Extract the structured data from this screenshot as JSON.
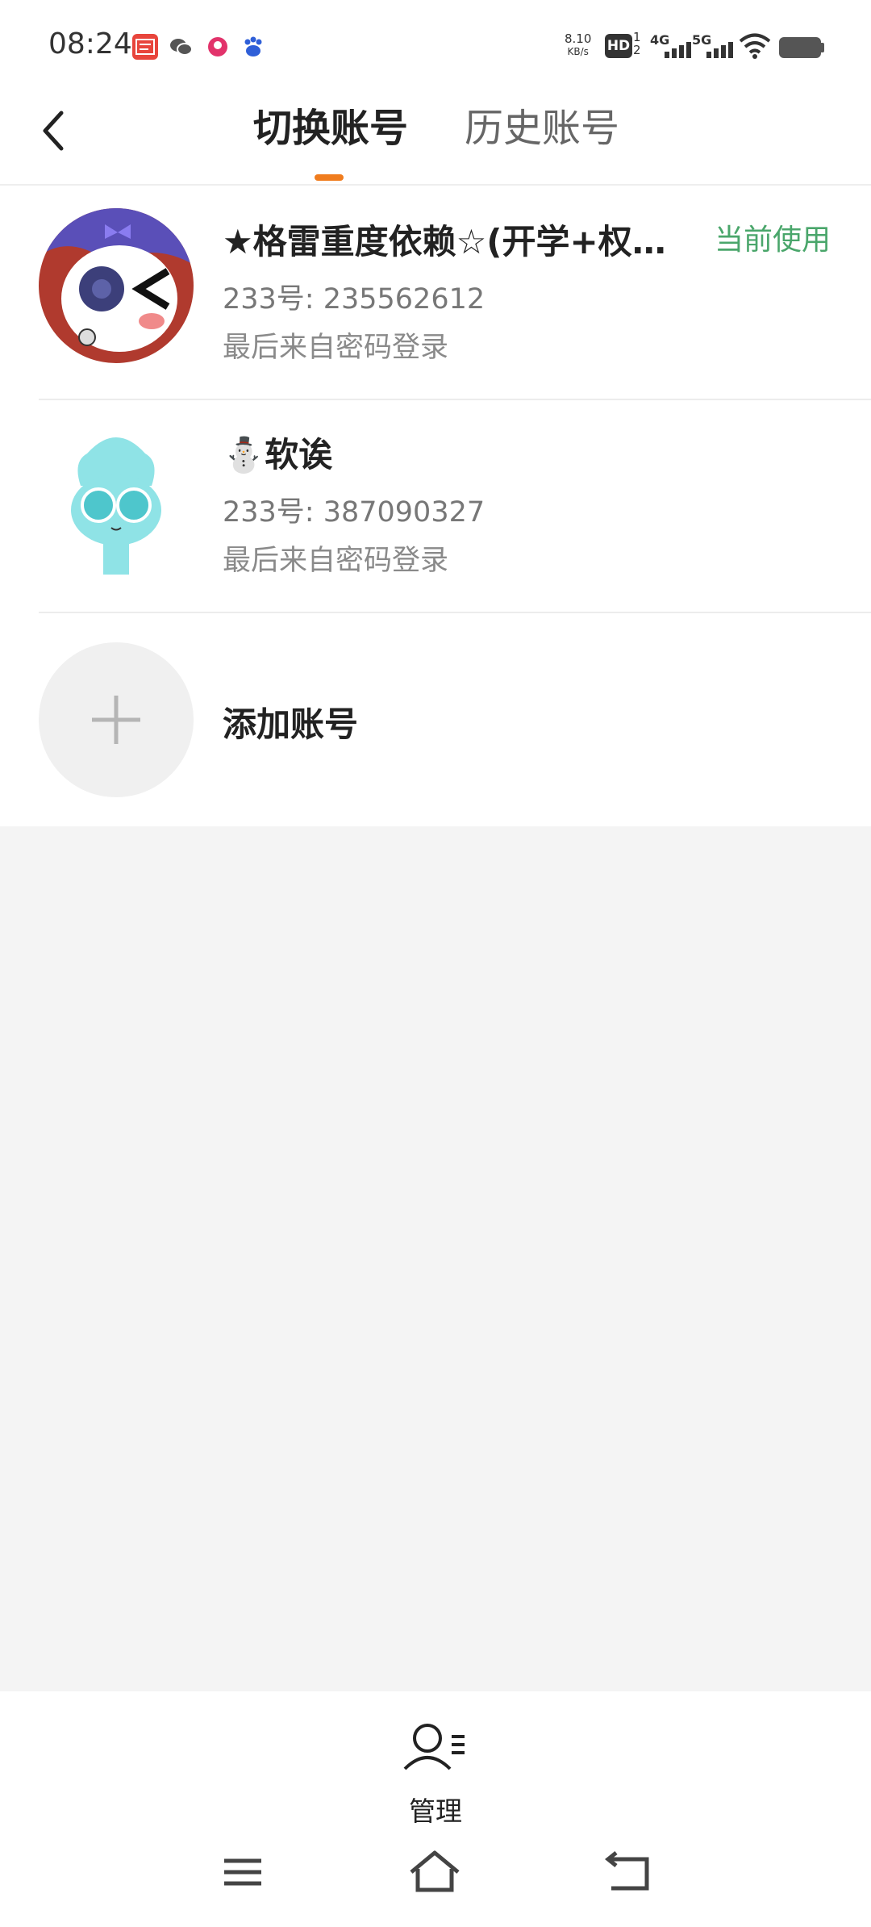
{
  "status_bar": {
    "time": "08:24",
    "net_speed_value": "8.10",
    "net_speed_unit": "KB/s",
    "hd_label": "HD",
    "sim_slots": "1\n2",
    "signal1_label": "4G",
    "signal2_label": "5G",
    "app_icons": [
      "toutiao-app-icon",
      "wechat-icon",
      "app-notification-icon",
      "baidu-icon"
    ]
  },
  "header": {
    "tabs": [
      {
        "label": "切换账号",
        "active": true
      },
      {
        "label": "历史账号",
        "active": false
      }
    ],
    "indicator_color": "#f07c1e"
  },
  "accounts": [
    {
      "name": "★格雷重度依赖☆(开学+权威...",
      "status": "当前使用",
      "id_text": "233号: 235562612",
      "login_text": "最后来自密码登录"
    },
    {
      "name": "⛄软诶",
      "id_text": "233号: 387090327",
      "login_text": "最后来自密码登录"
    }
  ],
  "add_account": {
    "label": "添加账号"
  },
  "bottom": {
    "manage_label": "管理",
    "nav": [
      "menu-icon",
      "home-icon",
      "back-icon"
    ]
  },
  "colors": {
    "accent": "#f07c1e",
    "status_green": "#4aa66b"
  }
}
